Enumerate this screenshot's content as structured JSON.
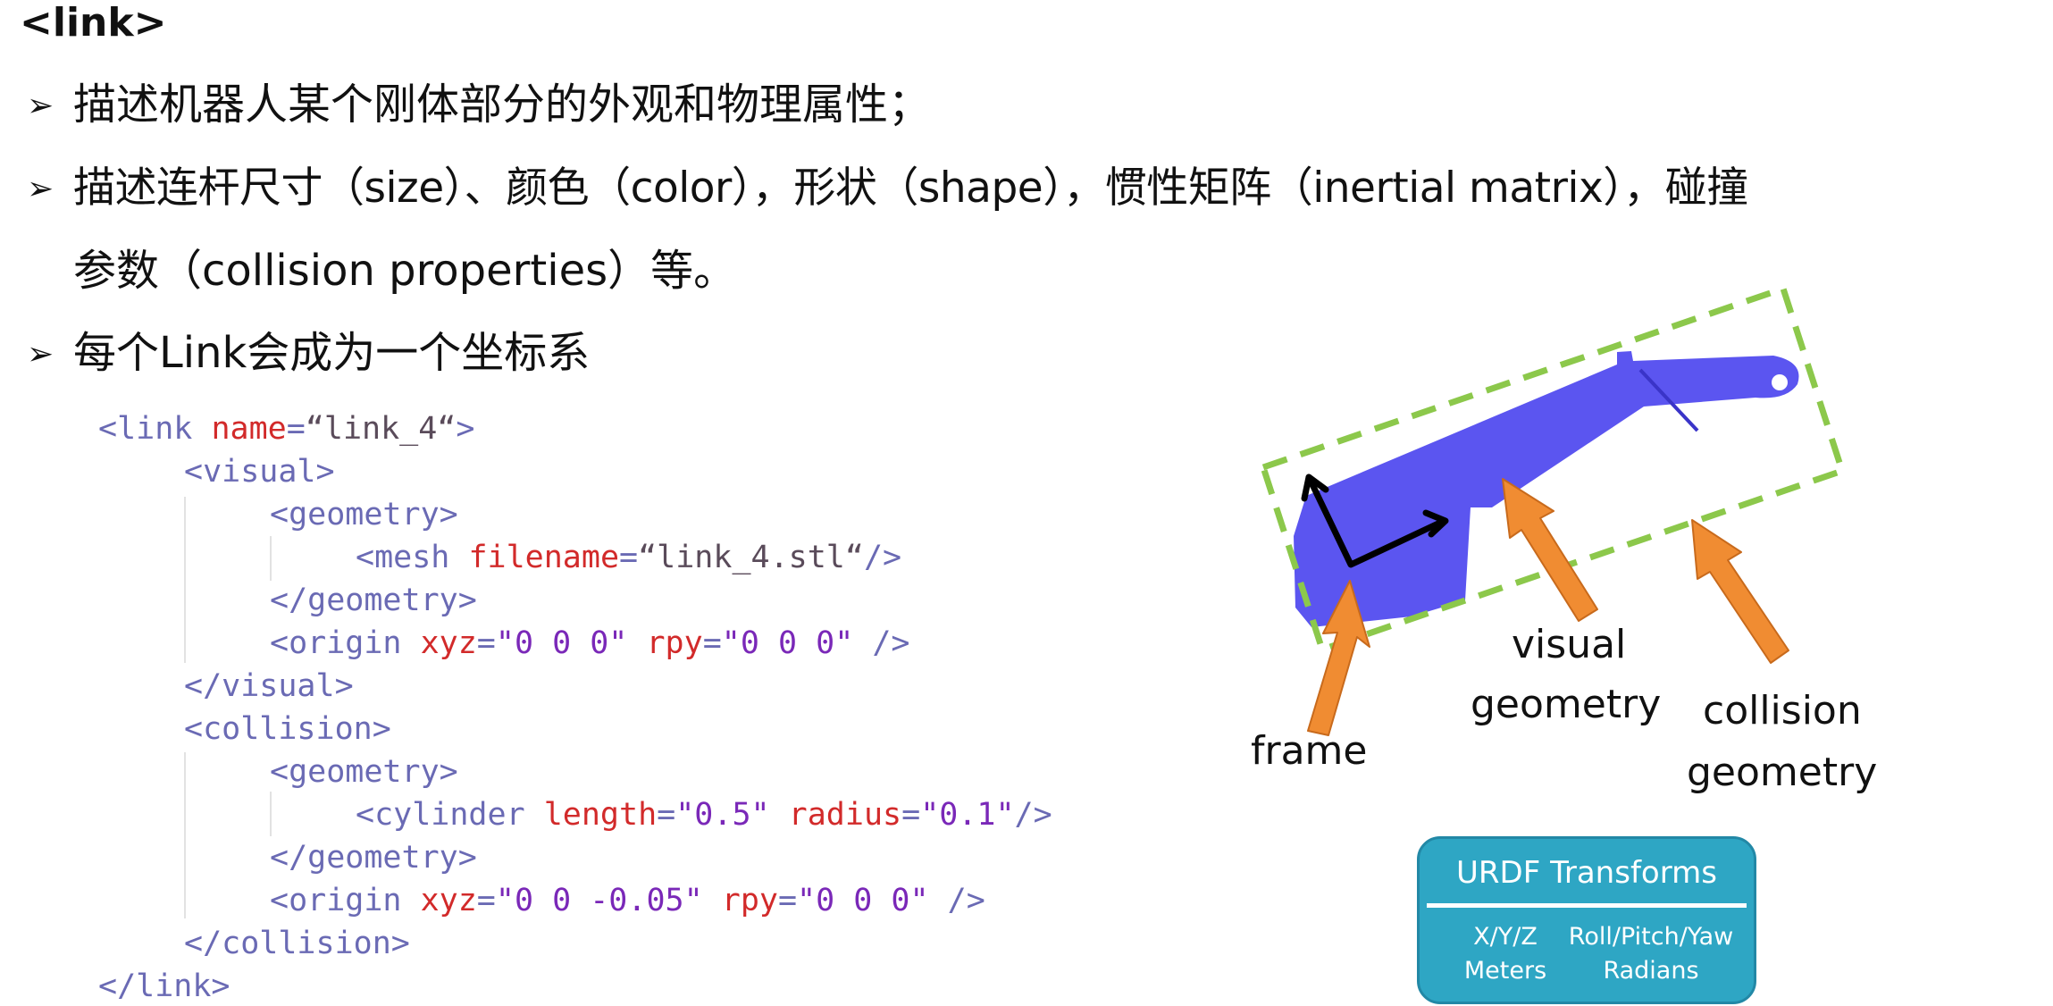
{
  "heading": "<link>",
  "bullets": [
    {
      "text": "描述机器人某个刚体部分的外观和物理属性；"
    },
    {
      "text": "描述连杆尺寸（size）、颜色（color），形状（shape），惯性矩阵（inertial  matrix），碰撞",
      "continuation": "参数（collision properties）等。"
    },
    {
      "text": "每个Link会成为一个坐标系"
    }
  ],
  "code": {
    "line1": {
      "open": "<link ",
      "a1": "name",
      "eq1": "=",
      "v1": "“link_4“",
      "close": ">"
    },
    "line2": {
      "tag": "<visual>"
    },
    "line3": {
      "tag": "<geometry>"
    },
    "line4": {
      "open": "<mesh ",
      "a1": "filename",
      "eq1": "=",
      "v1": "“link_4.stl“",
      "close": "/>"
    },
    "line5": {
      "tag": "</geometry>"
    },
    "line6": {
      "open": "<origin ",
      "a1": "xyz",
      "eq1": "=",
      "v1": "\"0 0 0\"",
      "a2": " rpy",
      "eq2": "=",
      "v2": "\"0 0 0\"",
      "close": " />"
    },
    "line7": {
      "tag": "</visual>"
    },
    "line8": {
      "tag": "<collision>"
    },
    "line9": {
      "tag": "<geometry>"
    },
    "line10": {
      "open": "<cylinder ",
      "a1": "length",
      "eq1": "=",
      "v1": "\"0.5\"",
      "a2": " radius",
      "eq2": "=",
      "v2": "\"0.1\"",
      "close": "/>"
    },
    "line11": {
      "tag": "</geometry>"
    },
    "line12": {
      "open": "<origin ",
      "a1": "xyz",
      "eq1": "=",
      "v1": "\"0 0 -0.05\"",
      "a2": " rpy",
      "eq2": "=",
      "v2": "\"0 0 0\"",
      "close": " />"
    },
    "line13": {
      "tag": "</collision>"
    },
    "line14": {
      "tag": "</link>"
    }
  },
  "diagram": {
    "labels": {
      "frame": "frame",
      "visual": "visual",
      "visual_2": "geometry",
      "collision": "collision",
      "collision_2": "geometry"
    },
    "colors": {
      "link_body": "#5b55f0",
      "collision_box": "#8cc84b",
      "arrow": "#f08c32",
      "axes": "#000000"
    }
  },
  "urdf_box": {
    "title": "URDF Transforms",
    "col1_line1": "X/Y/Z",
    "col1_line2": "Meters",
    "col2_line1": "Roll/Pitch/Yaw",
    "col2_line2": "Radians",
    "color": "#2ea6c4"
  }
}
